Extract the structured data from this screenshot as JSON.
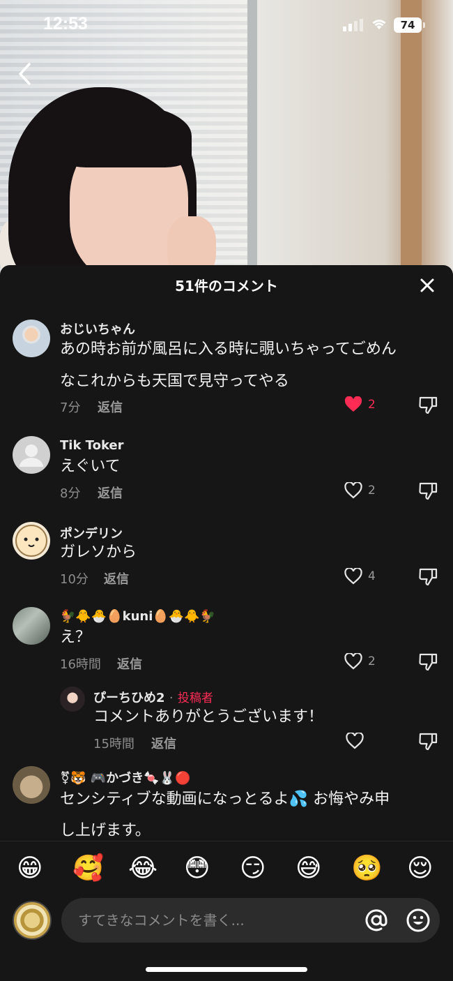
{
  "status_bar": {
    "time": "12:53",
    "battery": "74"
  },
  "panel": {
    "title": "51件のコメント"
  },
  "comments": [
    {
      "user": "おじいちゃん",
      "text_lines": [
        "あの時お前が風呂に入る時に覗いちゃってごめん",
        "なこれからも天国で見守ってやる"
      ],
      "time": "7分",
      "reply_label": "返信",
      "likes": "2",
      "liked": true
    },
    {
      "user": "Tik Toker",
      "text_lines": [
        "えぐいて"
      ],
      "time": "8分",
      "reply_label": "返信",
      "likes": "2",
      "liked": false
    },
    {
      "user": "ポンデリン",
      "text_lines": [
        "ガレソから"
      ],
      "time": "10分",
      "reply_label": "返信",
      "likes": "4",
      "liked": false
    },
    {
      "user": "🐓🐥🐣🥚kuni🥚🐣🐥🐓",
      "text_lines": [
        "え？"
      ],
      "time": "16時間",
      "reply_label": "返信",
      "likes": "2",
      "liked": false
    },
    {
      "user": "ぴーちひめ2",
      "author_separator": "·",
      "author_tag": "投稿者",
      "text_lines": [
        "コメントありがとうございます！"
      ],
      "time": "15時間",
      "reply_label": "返信",
      "likes": "",
      "liked": false,
      "is_reply": true
    },
    {
      "user": "⚧🐯 🎮かづき🍬🐰🔴",
      "text_lines": [
        "センシティブな動画になっとるよ💦 お悔やみ申",
        "し上げます。"
      ]
    }
  ],
  "emoji_bar": [
    "😁",
    "🥰",
    "😂",
    "😳",
    "😏",
    "😅",
    "🥺",
    "😌"
  ],
  "input": {
    "placeholder": "すてきなコメントを書く..."
  },
  "colors": {
    "background": "#161616",
    "accent_red": "#fe2c55",
    "muted_text": "#8d8d8d"
  }
}
